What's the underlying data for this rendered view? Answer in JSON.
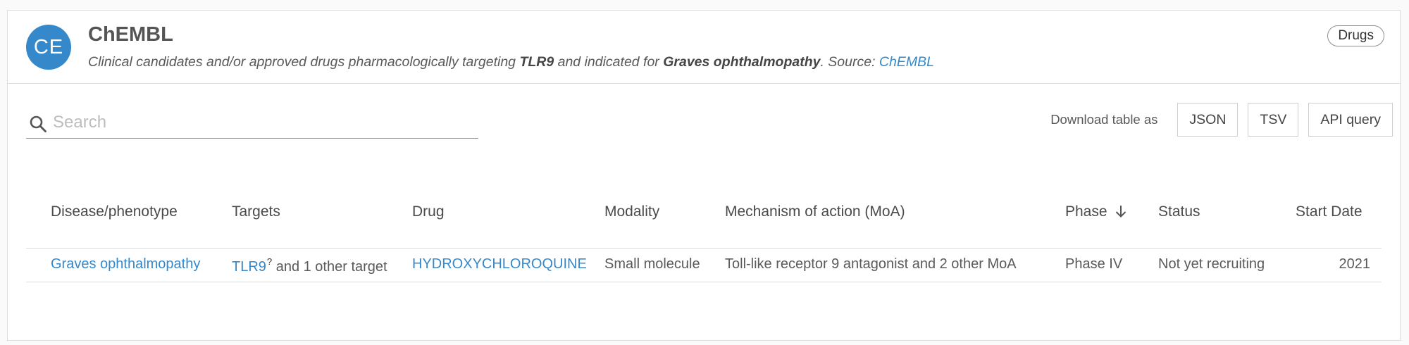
{
  "header": {
    "avatar_initials": "CE",
    "title": "ChEMBL",
    "subtitle_prefix": "Clinical candidates and/or approved drugs pharmacologically targeting ",
    "subtitle_target": "TLR9",
    "subtitle_mid": " and indicated for ",
    "subtitle_disease": "Graves ophthalmopathy",
    "subtitle_source_prefix": ". Source: ",
    "subtitle_source_link": "ChEMBL",
    "chip": "Drugs"
  },
  "search": {
    "placeholder": "Search",
    "value": ""
  },
  "downloads": {
    "label": "Download table as",
    "json": "JSON",
    "tsv": "TSV",
    "api": "API query"
  },
  "table": {
    "columns": {
      "disease": "Disease/phenotype",
      "targets": "Targets",
      "drug": "Drug",
      "modality": "Modality",
      "moa": "Mechanism of action (MoA)",
      "phase": "Phase",
      "status": "Status",
      "start_date": "Start Date"
    },
    "sort": {
      "column": "Phase",
      "direction": "descending"
    },
    "rows": [
      {
        "disease": "Graves ophthalmopathy",
        "target_link": "TLR9",
        "target_superscript": "?",
        "target_more": " and 1 other target",
        "drug": "HYDROXYCHLOROQUINE",
        "modality": "Small molecule",
        "moa": "Toll-like receptor 9 antagonist and 2 other MoA",
        "phase": "Phase IV",
        "status": "Not yet recruiting",
        "start_date": "2021"
      }
    ]
  },
  "colors": {
    "accent": "#3589ca",
    "border": "#dcdcdc",
    "text": "#5a5a5a"
  }
}
